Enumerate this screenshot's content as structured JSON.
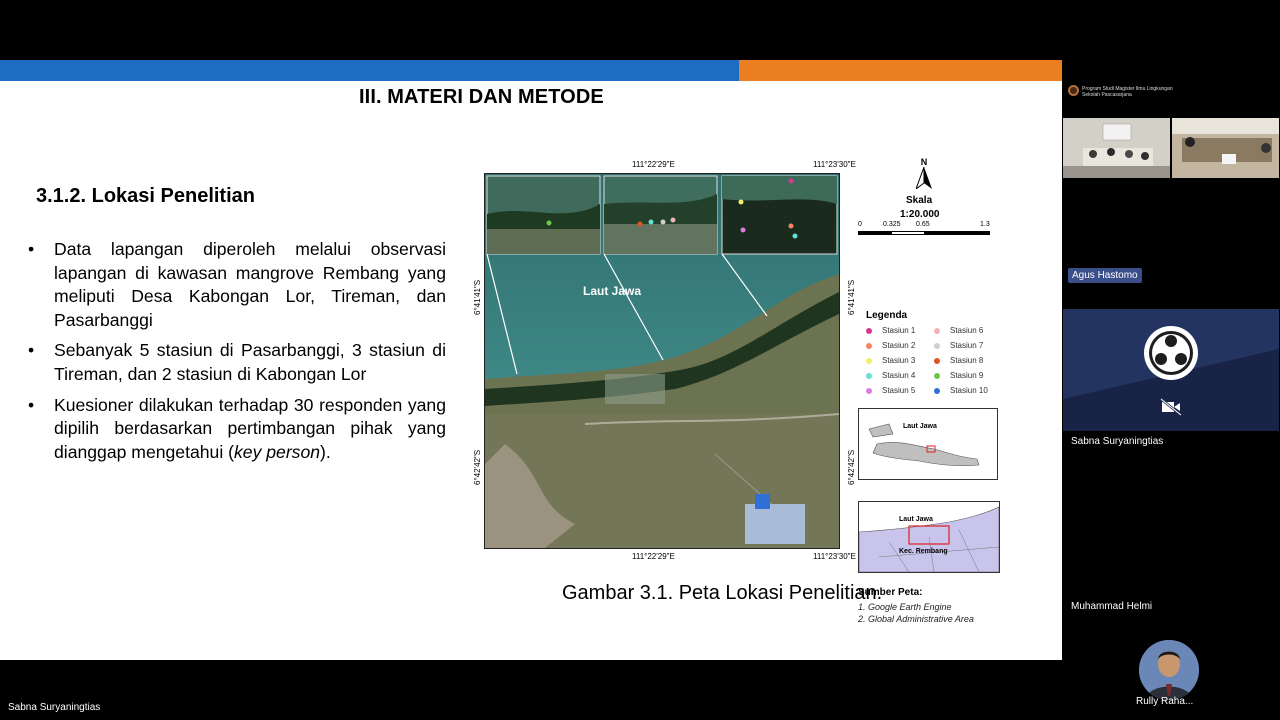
{
  "slide": {
    "title": "III. MATERI DAN METODE",
    "section_heading": "3.1.2. Lokasi Penelitian",
    "bullets": [
      "Data lapangan diperoleh melalui observasi lapangan di kawasan mangrove Rembang yang meliputi Desa Kabongan Lor, Tireman, dan Pasarbanggi",
      "Sebanyak 5 stasiun di Pasarbanggi, 3 stasiun di Tireman, dan 2 stasiun di Kabongan Lor"
    ],
    "bullet3": {
      "text": "Kuesioner dilakukan terhadap 30 responden yang dipilih berdasarkan pertimbangan pihak yang dianggap mengetahui (",
      "italic": "key person",
      "end": ")."
    },
    "caption": "Gambar 3.1. Peta Lokasi Penelitian.",
    "colors": {
      "bar_blue": "#1d6ec2",
      "bar_orange": "#ec7e22"
    }
  },
  "map": {
    "coord_top_1": "111°22'29\"E",
    "coord_top_2": "111°23'30\"E",
    "coord_bottom_1": "111°22'29\"E",
    "coord_bottom_2": "111°23'30\"E",
    "coord_left_1": "6°41'41\"S",
    "coord_left_2": "6°42'42\"S",
    "coord_right_1": "6°41'41\"S",
    "coord_right_2": "6°42'42\"S",
    "sea_label": "Laut Jawa",
    "north": "N",
    "scale_title": "Skala",
    "scale_ratio": "1:20.000",
    "scale_ticks": [
      "0",
      "0.325",
      "0.65",
      "1.3"
    ],
    "legend_title": "Legenda",
    "legend": [
      {
        "label": "Stasiun 1",
        "color": "#d6398a"
      },
      {
        "label": "Stasiun 6",
        "color": "#f0b3b3"
      },
      {
        "label": "Stasiun 2",
        "color": "#f5845c"
      },
      {
        "label": "Stasiun 7",
        "color": "#cfcfcf"
      },
      {
        "label": "Stasiun 3",
        "color": "#f4ee6b"
      },
      {
        "label": "Stasiun 8",
        "color": "#e0541f"
      },
      {
        "label": "Stasiun 4",
        "color": "#63e0d8"
      },
      {
        "label": "Stasiun 9",
        "color": "#6cc94a"
      },
      {
        "label": "Stasiun 5",
        "color": "#e07ee0"
      },
      {
        "label": "Stasiun 10",
        "color": "#2f6fd6"
      }
    ],
    "inset1": {
      "sea": "Laut Jawa"
    },
    "inset2": {
      "sea": "Laut Jawa",
      "region": "Kec. Rembang"
    },
    "source_title": "Sumber Peta:",
    "sources": [
      "1. Google Earth Engine",
      "2. Global Administrative Area"
    ]
  },
  "meeting": {
    "org_line1": "Program Studi Magister Ilmu Lingkungan",
    "org_line2": "Sekolah Pascasarjana",
    "participants": {
      "agus": "Agus Hastomo",
      "sabna_tile": "Sabna Suryaningtias",
      "helmi": "Muhammad Helmi",
      "rully": "Rully Raha..."
    },
    "speaker": "Sabna Suryaningtias"
  }
}
